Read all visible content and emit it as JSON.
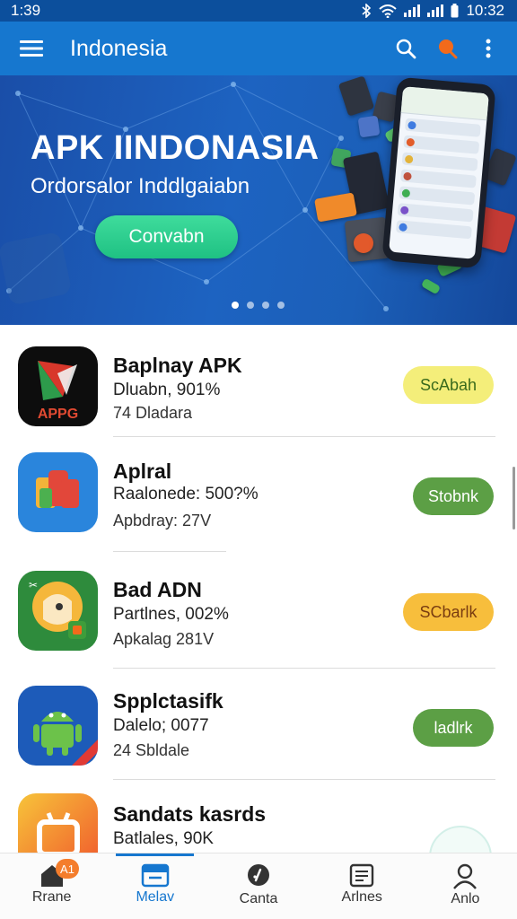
{
  "status_bar": {
    "time": "1:39",
    "clock": "10:32"
  },
  "app_bar": {
    "title": "Indonesia"
  },
  "banner": {
    "title": "APK IINDONASIA",
    "subtitle": "Ordorsalor Inddlgaiabn",
    "button_label": "Convabn",
    "pager_dots": 4,
    "active_dot": 0
  },
  "apps": [
    {
      "name": "Baplnay APK",
      "line1": "Dluabn, 901%",
      "line2": "74 Dladara",
      "action": "ScAbah",
      "action_color": "#f4ee7a",
      "action_text_color": "#3a6a1c",
      "icon": "apk-logo-icon",
      "icon_text": "APPG"
    },
    {
      "name": "Aplral",
      "line1": "Raalonede: 500?%",
      "line2": "Apbdray: 27V",
      "action": "Stobnk",
      "action_color": "#5c9f45",
      "action_text_color": "#ffffff",
      "icon": "colorful-blocks-icon"
    },
    {
      "name": "Bad ADN",
      "line1": "Partlnes, 002%",
      "line2": "Apkalag 281V",
      "action": "SCbarlk",
      "action_color": "#f7be3c",
      "action_text_color": "#7a3d10",
      "icon": "chat-face-icon"
    },
    {
      "name": "Spplctasifk",
      "line1": "Dalelo; 0077",
      "line2": "24 Sbldale",
      "action": "ladlrk",
      "action_color": "#5c9f45",
      "action_text_color": "#ffffff",
      "icon": "android-robot-icon"
    },
    {
      "name": "Sandats kasrds",
      "line1": "Batlales, 90K",
      "line2": "",
      "action": "",
      "action_color": "#d9f1ec",
      "action_text_color": "#ffffff",
      "icon": "orange-app-icon"
    }
  ],
  "bottom_nav": [
    {
      "label": "Rrane",
      "icon": "home-icon",
      "badge": "A1"
    },
    {
      "label": "Melav",
      "icon": "store-icon",
      "active": true
    },
    {
      "label": "Canta",
      "icon": "chat-bubble-icon"
    },
    {
      "label": "Arlnes",
      "icon": "document-list-icon"
    },
    {
      "label": "Anlo",
      "icon": "profile-icon"
    }
  ],
  "colors": {
    "primary": "#1677cf",
    "status_bar": "#0c4f9c",
    "banner_button": "#22c386"
  }
}
